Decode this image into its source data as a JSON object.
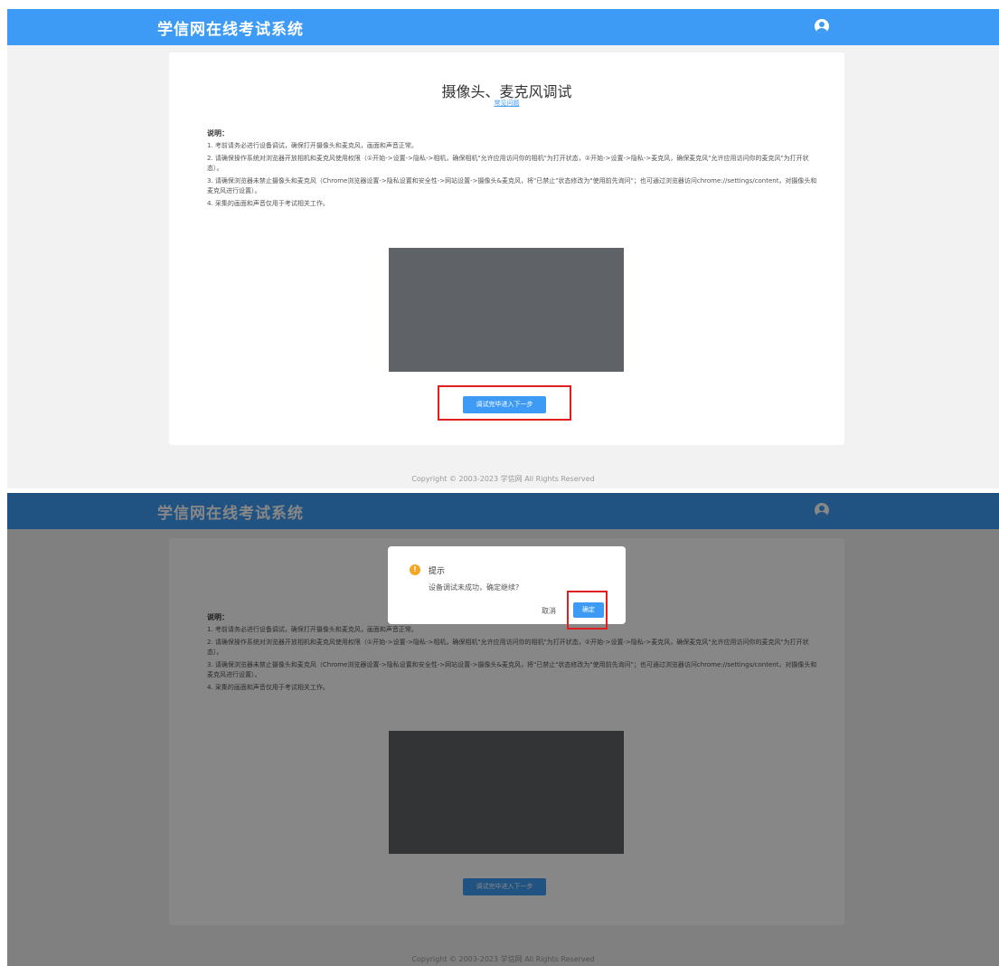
{
  "app": {
    "title": "学信网在线考试系统",
    "user_icon": "user-circle-icon"
  },
  "page": {
    "title": "摄像头、麦克风调试",
    "faq_link": "常见问题",
    "instructions_heading": "说明：",
    "instructions": [
      "1. 考前请务必进行设备调试，确保打开摄像头和麦克风，画面和声音正常。",
      "2. 请确保操作系统对浏览器开放相机和麦克风使用权限（①开始->设置->隐私->相机，确保相机\"允许应用访问你的相机\"为打开状态，②开始->设置->隐私->麦克风，确保麦克风\"允许应用访问你的麦克风\"为打开状态）。",
      "3. 请确保浏览器未禁止摄像头和麦克风（Chrome浏览器设置->隐私设置和安全性->网站设置->摄像头&麦克风，将\"已禁止\"状态修改为\"使用前先询问\"；也可通过浏览器访问chrome://settings/content，对摄像头和麦克风进行设置）。",
      "4. 采集的画面和声音仅用于考试相关工作。"
    ],
    "next_button": "调试完毕进入下一步"
  },
  "footer": {
    "copyright": "Copyright © 2003-2023 学信网 All Rights Reserved"
  },
  "dialog": {
    "icon": "warning-icon",
    "icon_glyph": "!",
    "title": "提示",
    "message": "设备调试未成功，确定继续?",
    "cancel": "取消",
    "confirm": "确定"
  },
  "colors": {
    "header": "#3d9bf5",
    "primary": "#3d9bf5",
    "highlight": "#e02020",
    "warning": "#f5a623",
    "camera_preview": "#5f6266"
  }
}
